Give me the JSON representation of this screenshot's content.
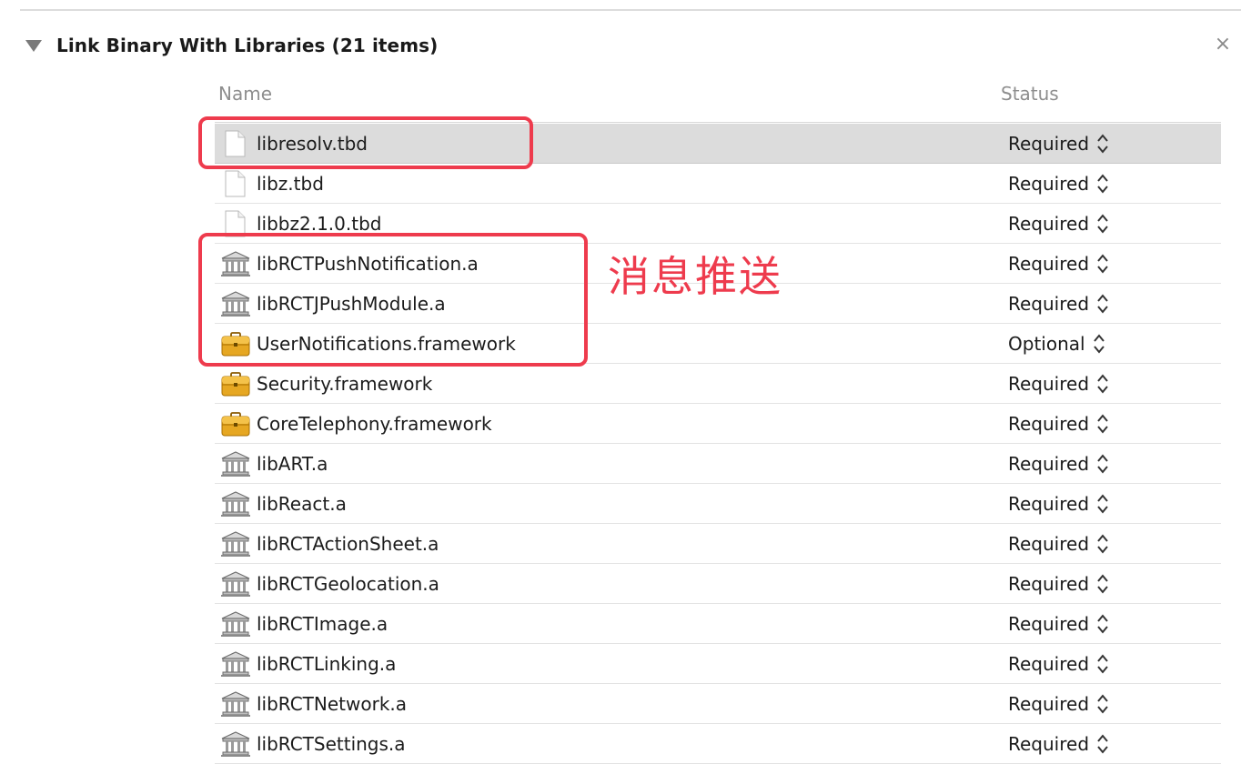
{
  "phase": {
    "title": "Link Binary With Libraries (21 items)",
    "close_label": "×"
  },
  "columns": {
    "name": "Name",
    "status": "Status"
  },
  "rows": [
    {
      "name": "libresolv.tbd",
      "status": "Required",
      "icon": "file-icon",
      "selected": true
    },
    {
      "name": "libz.tbd",
      "status": "Required",
      "icon": "file-icon"
    },
    {
      "name": "libbz2.1.0.tbd",
      "status": "Required",
      "icon": "file-icon"
    },
    {
      "name": "libRCTPushNotification.a",
      "status": "Required",
      "icon": "library-icon"
    },
    {
      "name": "libRCTJPushModule.a",
      "status": "Required",
      "icon": "library-icon"
    },
    {
      "name": "UserNotifications.framework",
      "status": "Optional",
      "icon": "framework-icon"
    },
    {
      "name": "Security.framework",
      "status": "Required",
      "icon": "framework-icon"
    },
    {
      "name": "CoreTelephony.framework",
      "status": "Required",
      "icon": "framework-icon"
    },
    {
      "name": "libART.a",
      "status": "Required",
      "icon": "library-icon"
    },
    {
      "name": "libReact.a",
      "status": "Required",
      "icon": "library-icon"
    },
    {
      "name": "libRCTActionSheet.a",
      "status": "Required",
      "icon": "library-icon"
    },
    {
      "name": "libRCTGeolocation.a",
      "status": "Required",
      "icon": "library-icon"
    },
    {
      "name": "libRCTImage.a",
      "status": "Required",
      "icon": "library-icon"
    },
    {
      "name": "libRCTLinking.a",
      "status": "Required",
      "icon": "library-icon"
    },
    {
      "name": "libRCTNetwork.a",
      "status": "Required",
      "icon": "library-icon"
    },
    {
      "name": "libRCTSettings.a",
      "status": "Required",
      "icon": "library-icon"
    }
  ],
  "annotation": {
    "text": "消息推送",
    "color": "#ee3b4d"
  },
  "colors": {
    "selected_row": "#dcdcdc",
    "annotation_red": "#ee3b4d",
    "framework_yellow": "#e6a722"
  }
}
